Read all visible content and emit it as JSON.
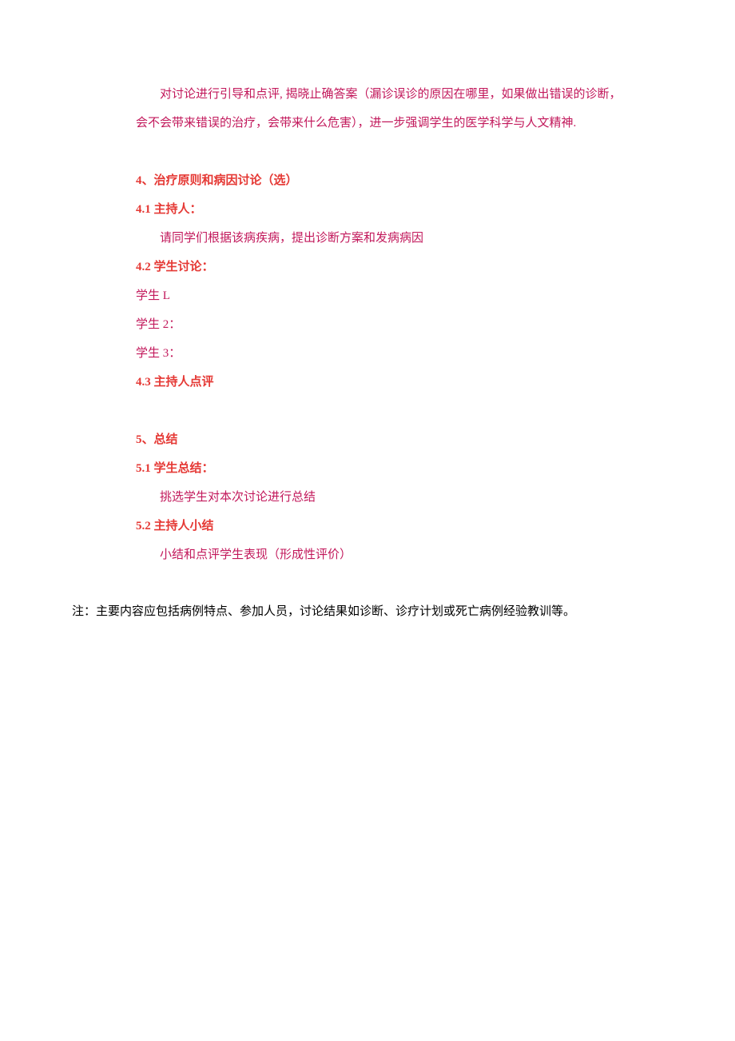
{
  "section3": {
    "intro_l1": "对讨论进行引导和点评, 揭晓止确答案（漏诊误诊的原因在哪里，如果做出错误的诊断，",
    "intro_l2": "会不会带来错误的治疗，会带来什么危害），进一步强调学生的医学科学与人文精神."
  },
  "section4": {
    "heading": "4、治疗原则和病因讨论（选）",
    "h41": "4.1 主持人：",
    "h41_body": "请同学们根据该病疾病，提出诊断方案和发病病因",
    "h42": "4.2 学生讨论：",
    "s1": "学生 L",
    "s2": "学生 2：",
    "s3": "学生 3：",
    "h43": "4.3 主持人点评"
  },
  "section5": {
    "heading": "5、总结",
    "h51": "5.1 学生总结：",
    "h51_body": "挑选学生对本次讨论进行总结",
    "h52": "5.2 主持人小结",
    "h52_body": "小结和点评学生表现（形成性评价）"
  },
  "note": "注：主要内容应包括病例特点、参加人员，讨论结果如诊断、诊疗计划或死亡病例经验教训等。"
}
